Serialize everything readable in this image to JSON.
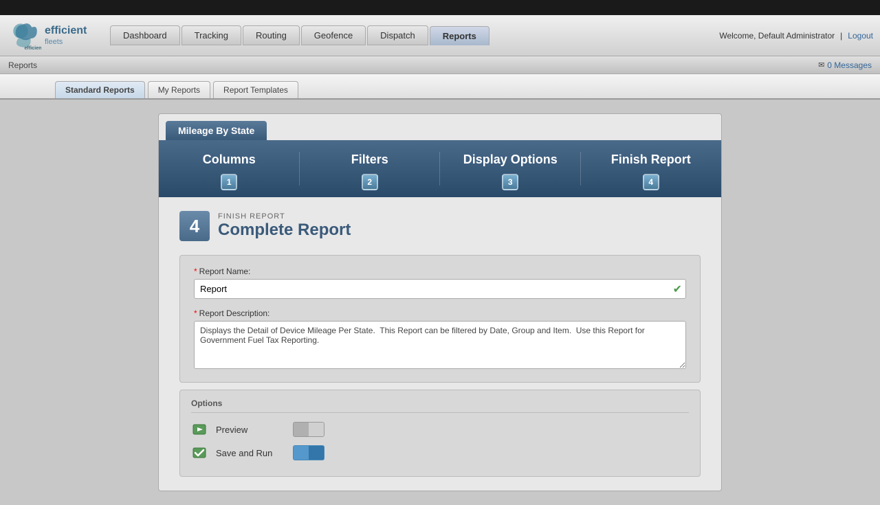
{
  "topbar": {
    "welcome_text": "Welcome,  Default Administrator",
    "logout_label": "Logout",
    "messages_label": "0 Messages"
  },
  "nav": {
    "tabs": [
      {
        "id": "dashboard",
        "label": "Dashboard",
        "active": false
      },
      {
        "id": "tracking",
        "label": "Tracking",
        "active": false
      },
      {
        "id": "routing",
        "label": "Routing",
        "active": false
      },
      {
        "id": "geofence",
        "label": "Geofence",
        "active": false
      },
      {
        "id": "dispatch",
        "label": "Dispatch",
        "active": false
      },
      {
        "id": "reports",
        "label": "Reports",
        "active": true
      }
    ]
  },
  "breadcrumb": {
    "text": "Reports"
  },
  "subtabs": [
    {
      "id": "standard",
      "label": "Standard Reports",
      "active": true
    },
    {
      "id": "my",
      "label": "My Reports",
      "active": false
    },
    {
      "id": "templates",
      "label": "Report Templates",
      "active": false
    }
  ],
  "report": {
    "title": "Mileage By State",
    "wizard_steps": [
      {
        "label": "Columns",
        "number": "1"
      },
      {
        "label": "Filters",
        "number": "2"
      },
      {
        "label": "Display Options",
        "number": "3"
      },
      {
        "label": "Finish Report",
        "number": "4"
      }
    ],
    "step_number": "4",
    "step_tag": "FINISH REPORT",
    "step_title": "Complete Report",
    "report_name_label": "Report Name:",
    "report_name_value": "Report",
    "report_description_label": "Report Description:",
    "report_description_value": "Displays the Detail of Device Mileage Per State.  This Report can be filtered by Date, Group and Item.  Use this Report for Government Fuel Tax Reporting.",
    "options_title": "Options",
    "option_preview_label": "Preview",
    "option_save_run_label": "Save and Run"
  }
}
